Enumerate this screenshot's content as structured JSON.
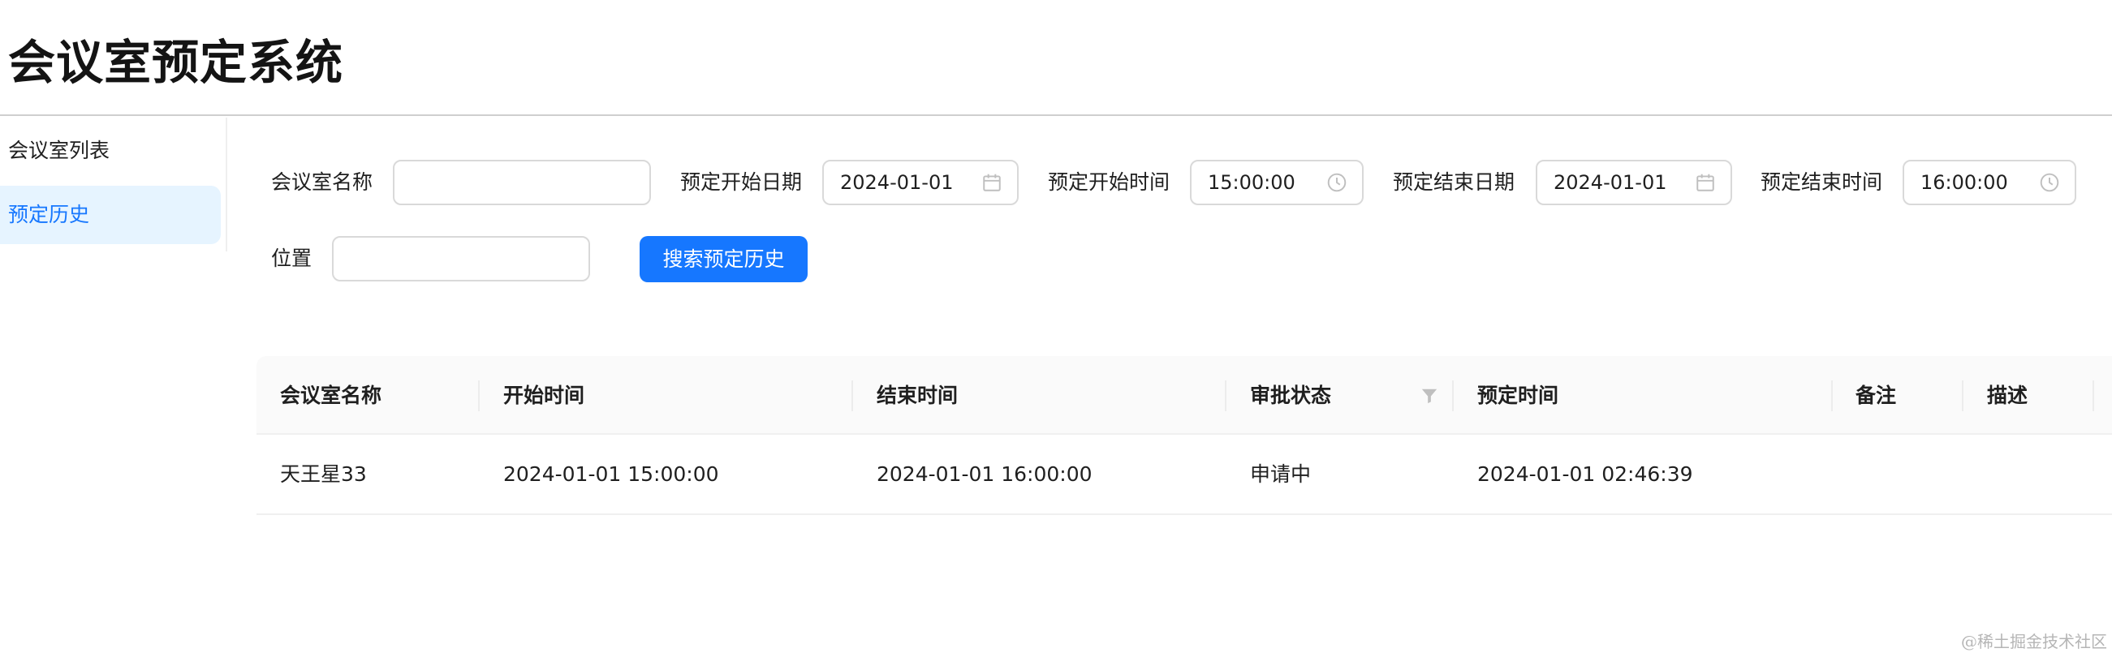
{
  "app": {
    "title": "会议室预定系统"
  },
  "sidebar": {
    "items": [
      {
        "label": "会议室列表",
        "active": false
      },
      {
        "label": "预定历史",
        "active": true
      }
    ]
  },
  "search_form": {
    "room_name": {
      "label": "会议室名称",
      "value": ""
    },
    "start_date": {
      "label": "预定开始日期",
      "value": "2024-01-01",
      "icon": "calendar-icon"
    },
    "start_time": {
      "label": "预定开始时间",
      "value": "15:00:00",
      "icon": "clock-icon"
    },
    "end_date": {
      "label": "预定结束日期",
      "value": "2024-01-01",
      "icon": "calendar-icon"
    },
    "end_time": {
      "label": "预定结束时间",
      "value": "16:00:00",
      "icon": "clock-icon"
    },
    "location": {
      "label": "位置",
      "value": ""
    },
    "search_button": "搜索预定历史"
  },
  "table": {
    "columns": [
      "会议室名称",
      "开始时间",
      "结束时间",
      "审批状态",
      "预定时间",
      "备注",
      "描述"
    ],
    "filter_icon": "filter-icon",
    "rows": [
      {
        "room_name": "天王星33",
        "start_time": "2024-01-01 15:00:00",
        "end_time": "2024-01-01 16:00:00",
        "status": "申请中",
        "booking_time": "2024-01-01 02:46:39",
        "note": "",
        "description": ""
      }
    ]
  },
  "watermark": "@稀土掘金技术社区",
  "colors": {
    "primary": "#1677ff",
    "active_bg": "#e6f4ff",
    "header_border": "#cfcfcf",
    "table_header_bg": "#fafafa"
  }
}
